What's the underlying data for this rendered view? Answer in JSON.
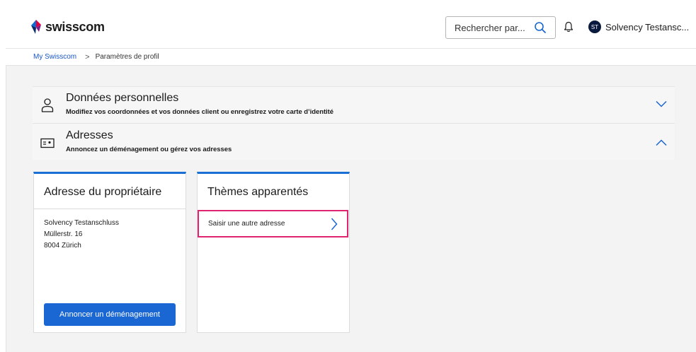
{
  "header": {
    "brand": "swisscom",
    "search_placeholder": "Rechercher par...",
    "user_initials": "ST",
    "user_name": "Solvency Testansc..."
  },
  "breadcrumb": {
    "home": "My Swisscom",
    "current": "Paramètres de profil"
  },
  "accordion": [
    {
      "title": "Données personnelles",
      "subtitle": "Modifiez vos coordonnées et vos données client ou enregistrez votre carte d’identité",
      "icon": "person-icon",
      "state": "collapsed"
    },
    {
      "title": "Adresses",
      "subtitle": "Annoncez un déménagement ou gérez vos adresses",
      "icon": "address-card-icon",
      "state": "expanded"
    }
  ],
  "owner_card": {
    "title": "Adresse du propriétaire",
    "name": "Solvency Testanschluss",
    "street": "Müllerstr. 16",
    "city": "8004 Zürich",
    "button": "Annoncer un déménagement"
  },
  "related_card": {
    "title": "Thèmes apparentés",
    "link": "Saisir une autre adresse"
  },
  "colors": {
    "accent": "#1a66d3",
    "highlight": "#e0246f",
    "breadcrumb_link": "#1a56c8"
  }
}
